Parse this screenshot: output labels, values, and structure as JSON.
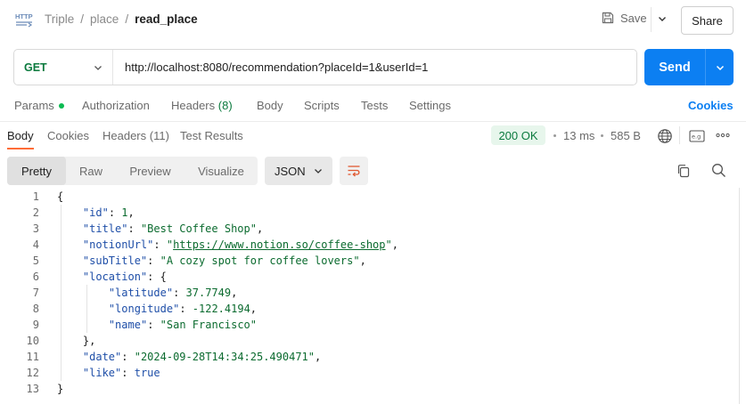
{
  "header": {
    "breadcrumb": [
      "Triple",
      "place"
    ],
    "current": "read_place",
    "save_label": "Save",
    "share_label": "Share"
  },
  "request": {
    "method": "GET",
    "url": "http://localhost:8080/recommendation?placeId=1&userId=1",
    "send_label": "Send"
  },
  "request_tabs": {
    "params": "Params",
    "authorization": "Authorization",
    "headers": "Headers",
    "headers_count": "(8)",
    "body": "Body",
    "scripts": "Scripts",
    "tests": "Tests",
    "settings": "Settings",
    "cookies": "Cookies"
  },
  "response_tabs": {
    "body": "Body",
    "cookies": "Cookies",
    "headers": "Headers (11)",
    "test_results": "Test Results"
  },
  "response_meta": {
    "status": "200 OK",
    "time": "13 ms",
    "size": "585 B"
  },
  "format": {
    "options": [
      "Pretty",
      "Raw",
      "Preview",
      "Visualize"
    ],
    "active": "Pretty",
    "language": "JSON"
  },
  "code_lines": [
    {
      "ln": "1",
      "text": "{"
    },
    {
      "ln": "2",
      "key": "\"id\"",
      "value": "1",
      "vtype": "n",
      "tail": ","
    },
    {
      "ln": "3",
      "key": "\"title\"",
      "value": "\"Best Coffee Shop\"",
      "vtype": "s",
      "tail": ","
    },
    {
      "ln": "4",
      "key": "\"notionUrl\"",
      "value": "\"https://www.notion.so/coffee-shop\"",
      "vtype": "link",
      "tail": ","
    },
    {
      "ln": "5",
      "key": "\"subTitle\"",
      "value": "\"A cozy spot for coffee lovers\"",
      "vtype": "s",
      "tail": ","
    },
    {
      "ln": "6",
      "key": "\"location\"",
      "value": "{",
      "vtype": "p",
      "tail": ""
    },
    {
      "ln": "7",
      "key": "\"latitude\"",
      "value": "37.7749",
      "vtype": "n",
      "tail": ","
    },
    {
      "ln": "8",
      "key": "\"longitude\"",
      "value": "-122.4194",
      "vtype": "n",
      "tail": ","
    },
    {
      "ln": "9",
      "key": "\"name\"",
      "value": "\"San Francisco\"",
      "vtype": "s",
      "tail": ""
    },
    {
      "ln": "10",
      "text": "},"
    },
    {
      "ln": "11",
      "key": "\"date\"",
      "value": "\"2024-09-28T14:34:25.490471\"",
      "vtype": "s",
      "tail": ","
    },
    {
      "ln": "12",
      "key": "\"like\"",
      "value": "true",
      "vtype": "b",
      "tail": ""
    },
    {
      "ln": "13",
      "text": "}"
    }
  ]
}
